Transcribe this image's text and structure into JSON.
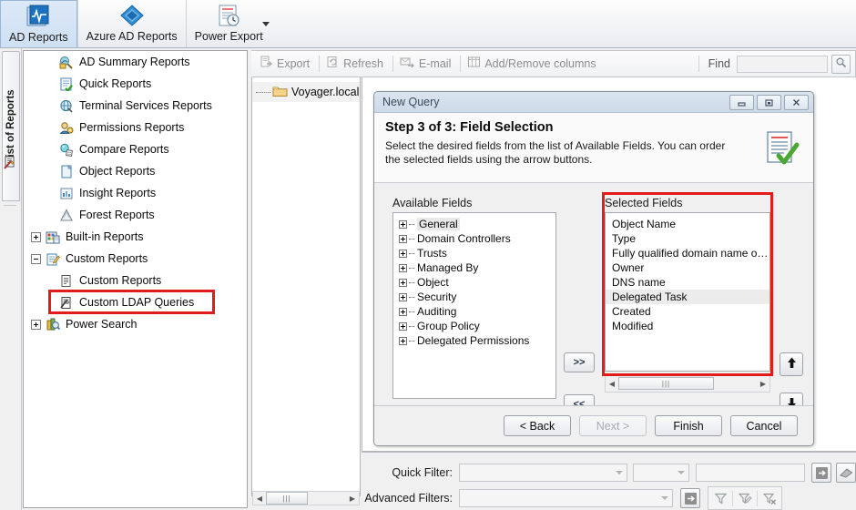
{
  "ribbon": {
    "tabs": [
      {
        "label": "AD Reports",
        "icon": "ad-reports-icon",
        "active": true,
        "dropdown": false
      },
      {
        "label": "Azure AD Reports",
        "icon": "azure-ad-reports-icon",
        "active": false,
        "dropdown": false
      },
      {
        "label": "Power Export",
        "icon": "power-export-icon",
        "active": false,
        "dropdown": true
      }
    ]
  },
  "vertical_tab": {
    "label": "List of Reports",
    "icon": "report-wizard-icon"
  },
  "sidebar": {
    "items": [
      {
        "label": "AD Summary Reports",
        "icon": "summary-reports-icon",
        "expander": "none",
        "indent": 1
      },
      {
        "label": "Quick Reports",
        "icon": "quick-reports-icon",
        "expander": "none",
        "indent": 1
      },
      {
        "label": "Terminal Services Reports",
        "icon": "terminal-services-icon",
        "expander": "none",
        "indent": 1
      },
      {
        "label": "Permissions Reports",
        "icon": "permissions-icon",
        "expander": "none",
        "indent": 1
      },
      {
        "label": "Compare Reports",
        "icon": "compare-reports-icon",
        "expander": "none",
        "indent": 1
      },
      {
        "label": "Object Reports",
        "icon": "object-reports-icon",
        "expander": "none",
        "indent": 1
      },
      {
        "label": "Insight Reports",
        "icon": "insight-reports-icon",
        "expander": "none",
        "indent": 1
      },
      {
        "label": "Forest Reports",
        "icon": "forest-reports-icon",
        "expander": "none",
        "indent": 1
      },
      {
        "label": "Built-in Reports",
        "icon": "builtin-reports-icon",
        "expander": "plus",
        "indent": 0
      },
      {
        "label": "Custom Reports",
        "icon": "custom-reports-icon",
        "expander": "minus",
        "indent": 0
      },
      {
        "label": "Custom Reports",
        "icon": "custom-report-leaf-icon",
        "expander": "none",
        "indent": 2
      },
      {
        "label": "Custom LDAP Queries",
        "icon": "ldap-query-icon",
        "expander": "none",
        "indent": 2,
        "highlighted": true
      },
      {
        "label": "Power Search",
        "icon": "power-search-icon",
        "expander": "plus",
        "indent": 0
      }
    ],
    "highlight_color": "#e21b1b"
  },
  "toolbar": {
    "buttons": [
      {
        "label": "Export",
        "icon": "export-icon"
      },
      {
        "label": "Refresh",
        "icon": "refresh-icon"
      },
      {
        "label": "E-mail",
        "icon": "email-icon"
      },
      {
        "label": "Add/Remove columns",
        "icon": "columns-icon"
      }
    ],
    "find_label": "Find",
    "find_value": "",
    "find_placeholder": "",
    "find_icon": "search-icon"
  },
  "domain_tree": {
    "root_label": "Voyager.local",
    "root_icon": "folder-icon"
  },
  "dialog": {
    "title": "New Query",
    "window_buttons": [
      {
        "name": "minimize-button",
        "glyph": "–"
      },
      {
        "name": "restore-button",
        "glyph": "□"
      },
      {
        "name": "close-button",
        "glyph": "✕"
      }
    ],
    "step_title": "Step 3 of 3:  Field Selection",
    "description": "Select the desired fields from the list of Available Fields. You can order the selected fields using the arrow buttons.",
    "header_icon": "field-selection-icon",
    "available_label": "Available Fields",
    "available_fields": [
      "General",
      "Domain Controllers",
      "Trusts",
      "Managed By",
      "Object",
      "Security",
      "Auditing",
      "Group Policy",
      "Delegated Permissions"
    ],
    "available_highlighted": "General",
    "selected_label": "Selected Fields",
    "selected_fields": [
      "Object Name",
      "Type",
      "Fully qualified domain name of obj...",
      "Owner",
      "DNS name",
      "Delegated Task",
      "Created",
      "Modified"
    ],
    "selected_highlighted": "Delegated Task",
    "transfer_add_label": ">>",
    "transfer_remove_label": "<<",
    "move_up_icon": "arrow-up-icon",
    "move_down_icon": "arrow-down-icon",
    "footer_buttons": [
      {
        "label": "< Back",
        "name": "back-button",
        "disabled": false
      },
      {
        "label": "Next >",
        "name": "next-button",
        "disabled": true
      },
      {
        "label": "Finish",
        "name": "finish-button",
        "disabled": false
      },
      {
        "label": "Cancel",
        "name": "cancel-button",
        "disabled": false
      }
    ]
  },
  "filters": {
    "quick_filter_label": "Quick Filter:",
    "quick_filter_value": "",
    "quick_filter_operator": "",
    "quick_filter_text": "",
    "quick_apply_icon": "apply-arrow-icon",
    "quick_clear_icon": "eraser-icon",
    "advanced_filters_label": "Advanced Filters:",
    "advanced_filters_value": "",
    "advanced_apply_icon": "apply-arrow-icon",
    "advanced_icons": [
      {
        "name": "filter-icon"
      },
      {
        "name": "filter-edit-icon"
      },
      {
        "name": "filter-clear-icon"
      }
    ]
  }
}
